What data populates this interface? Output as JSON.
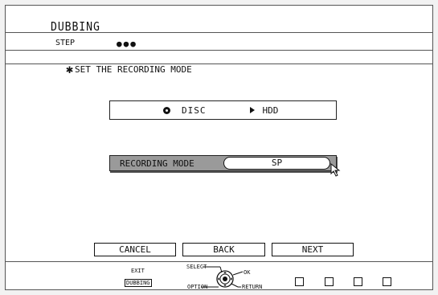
{
  "header": {
    "title": "DUBBING",
    "step_label": "STEP",
    "step_dots": "●●●"
  },
  "instruction": {
    "star": "✱",
    "text": "SET THE RECORDING MODE"
  },
  "dubbing_direction": {
    "source_icon": "disc-icon",
    "source": "DISC",
    "arrow_icon": "arrow-right-icon",
    "destination": "HDD"
  },
  "recording_mode": {
    "label": "RECORDING MODE",
    "value": "SP"
  },
  "buttons": {
    "cancel": "CANCEL",
    "back": "BACK",
    "next": "NEXT"
  },
  "footer": {
    "exit_label": "EXIT",
    "dubbing_key": "DUBBING",
    "select_label": "SELECT",
    "ok_label": "OK",
    "option_label": "OPTION",
    "return_label": "RETURN"
  }
}
